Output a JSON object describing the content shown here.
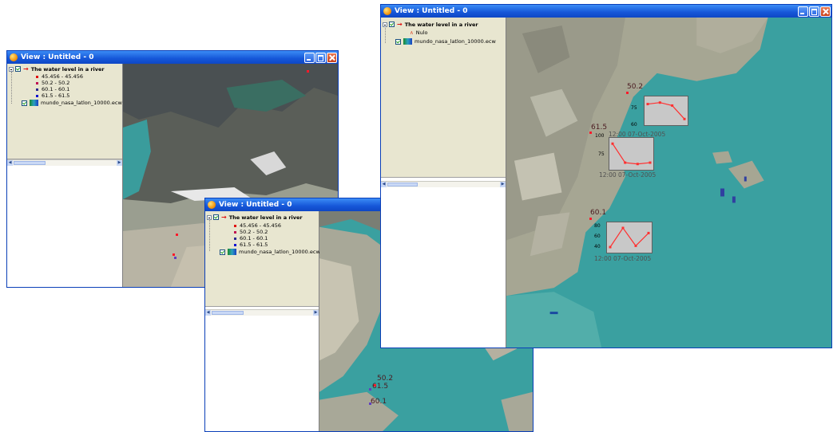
{
  "window_title": "View : Untitled - 0",
  "layer_vector": "The water level in a river",
  "layer_raster": "mundo_nasa_latlon_10000.ecw",
  "legend_items": [
    {
      "label": "45.456 - 45.456",
      "color": "#e01010"
    },
    {
      "label": "50.2 - 50.2",
      "color": "#c01050"
    },
    {
      "label": "60.1 - 60.1",
      "color": "#2a2a90"
    },
    {
      "label": "61.5 - 61.5",
      "color": "#1010d0"
    }
  ],
  "nulo_label": "Nulo",
  "points": [
    "50.2",
    "61.5",
    "60.1"
  ],
  "charts": [
    {
      "id": "50.2",
      "ticks": [
        "75",
        "60"
      ],
      "time": "12:00 07-Oct-2005",
      "values": [
        78,
        80,
        76,
        58
      ]
    },
    {
      "id": "61.5",
      "ticks": [
        "100",
        "75"
      ],
      "time": "12:00 07-Oct-2005",
      "values": [
        100,
        72,
        70,
        72
      ]
    },
    {
      "id": "60.1",
      "ticks": [
        "80",
        "60",
        "40"
      ],
      "time": "12:00 07-Oct-2005",
      "values": [
        50,
        80,
        52,
        72
      ]
    }
  ],
  "colors": {
    "titlebar": "#1556d8",
    "sea": "#3aa0a0",
    "toc_bg": "#e8e6d0",
    "chart_line": "#ff3030"
  },
  "icons": [
    "app-icon",
    "minimize-icon",
    "maximize-icon",
    "close-icon",
    "checkbox-icon",
    "expander-icon",
    "red-arrow-layer-icon",
    "raster-layer-icon"
  ]
}
